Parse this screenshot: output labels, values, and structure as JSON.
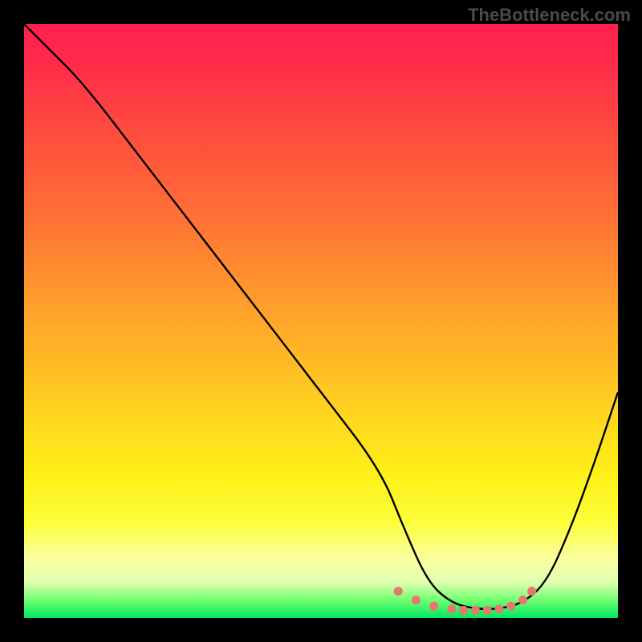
{
  "watermark": "TheBottleneck.com",
  "chart_data": {
    "type": "line",
    "title": "",
    "xlabel": "",
    "ylabel": "",
    "xlim": [
      0,
      100
    ],
    "ylim": [
      0,
      100
    ],
    "series": [
      {
        "name": "bottleneck-curve",
        "x": [
          0,
          4,
          10,
          20,
          30,
          40,
          50,
          60,
          64,
          68,
          72,
          76,
          80,
          84,
          88,
          92,
          96,
          100
        ],
        "values": [
          100,
          96,
          90,
          77,
          64,
          51,
          38,
          25,
          15,
          6,
          2.5,
          1.5,
          1.5,
          2.5,
          6,
          15,
          26,
          38
        ]
      }
    ],
    "markers": {
      "name": "highlighted-range",
      "color": "#e8776e",
      "x": [
        63,
        66,
        69,
        72,
        74,
        76,
        78,
        80,
        82,
        84,
        85.5
      ],
      "values": [
        4.5,
        3,
        2,
        1.5,
        1.3,
        1.3,
        1.3,
        1.5,
        2,
        3,
        4.5
      ]
    },
    "gradient_stops": [
      {
        "pct": 0,
        "color": "#ff1f4f"
      },
      {
        "pct": 50,
        "color": "#ffb028"
      },
      {
        "pct": 85,
        "color": "#fdff50"
      },
      {
        "pct": 100,
        "color": "#00e861"
      }
    ]
  }
}
